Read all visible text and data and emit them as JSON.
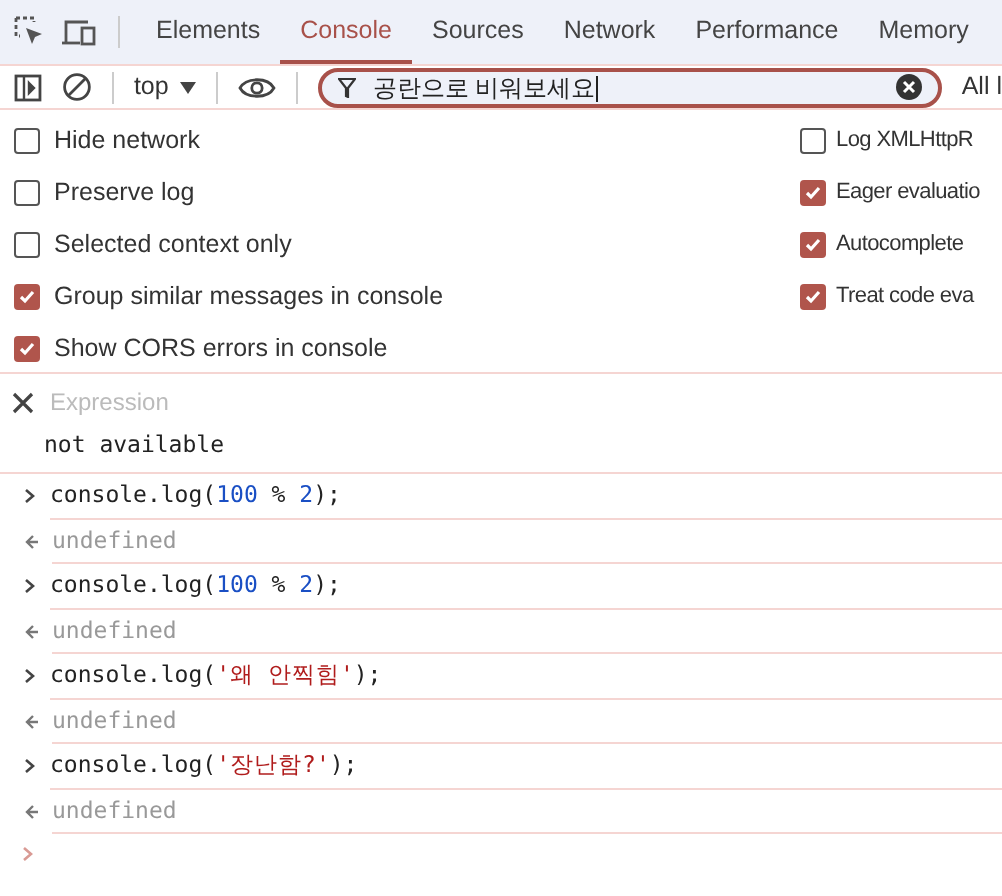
{
  "tabs": [
    {
      "label": "Elements",
      "selected": false
    },
    {
      "label": "Console",
      "selected": true
    },
    {
      "label": "Sources",
      "selected": false
    },
    {
      "label": "Network",
      "selected": false
    },
    {
      "label": "Performance",
      "selected": false
    },
    {
      "label": "Memory",
      "selected": false
    }
  ],
  "toolbar": {
    "context": "top",
    "filter_value": "공란으로 비워보세요",
    "levels": "All l"
  },
  "settings_left": [
    {
      "label": "Hide network",
      "checked": false
    },
    {
      "label": "Preserve log",
      "checked": false
    },
    {
      "label": "Selected context only",
      "checked": false
    },
    {
      "label": "Group similar messages in console",
      "checked": true
    },
    {
      "label": "Show CORS errors in console",
      "checked": true
    }
  ],
  "settings_right": [
    {
      "label": "Log XMLHttpR",
      "checked": false
    },
    {
      "label": "Eager evaluatio",
      "checked": true
    },
    {
      "label": "Autocomplete",
      "checked": true
    },
    {
      "label": "Treat code eva",
      "checked": true
    }
  ],
  "live_expression": {
    "placeholder": "Expression",
    "value": "not available"
  },
  "console_lines": [
    {
      "kind": "input",
      "tokens": [
        {
          "kind": "plain",
          "text": "console.log("
        },
        {
          "kind": "number",
          "text": "100"
        },
        {
          "kind": "plain",
          "text": " % "
        },
        {
          "kind": "number",
          "text": "2"
        },
        {
          "kind": "plain",
          "text": ");"
        }
      ]
    },
    {
      "kind": "output",
      "tokens": [
        {
          "kind": "plain",
          "text": "undefined"
        }
      ]
    },
    {
      "kind": "input",
      "tokens": [
        {
          "kind": "plain",
          "text": "console.log("
        },
        {
          "kind": "number",
          "text": "100"
        },
        {
          "kind": "plain",
          "text": " % "
        },
        {
          "kind": "number",
          "text": "2"
        },
        {
          "kind": "plain",
          "text": ");"
        }
      ]
    },
    {
      "kind": "output",
      "tokens": [
        {
          "kind": "plain",
          "text": "undefined"
        }
      ]
    },
    {
      "kind": "input",
      "tokens": [
        {
          "kind": "plain",
          "text": "console.log("
        },
        {
          "kind": "string",
          "text": "'왜 안찍힘'"
        },
        {
          "kind": "plain",
          "text": ");"
        }
      ]
    },
    {
      "kind": "output",
      "tokens": [
        {
          "kind": "plain",
          "text": "undefined"
        }
      ]
    },
    {
      "kind": "input",
      "tokens": [
        {
          "kind": "plain",
          "text": "console.log("
        },
        {
          "kind": "string",
          "text": "'장난함?'"
        },
        {
          "kind": "plain",
          "text": ");"
        }
      ]
    },
    {
      "kind": "output",
      "tokens": [
        {
          "kind": "plain",
          "text": "undefined"
        }
      ]
    }
  ]
}
